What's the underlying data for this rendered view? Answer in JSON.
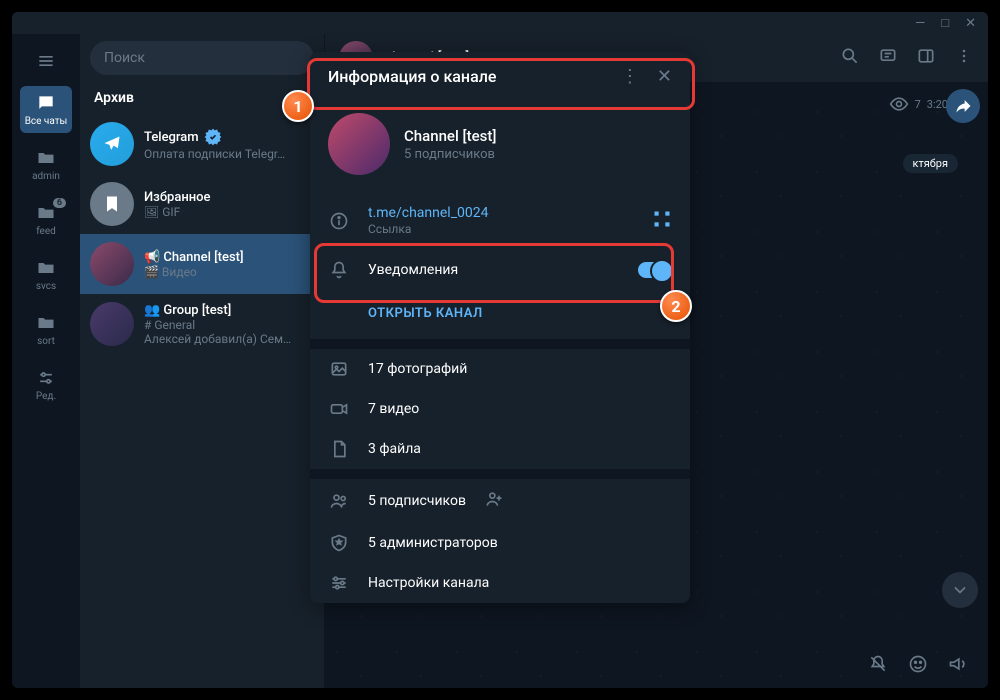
{
  "titlebar": {
    "minimize": "—",
    "maximize": "□",
    "close": "✕"
  },
  "search": {
    "placeholder": "Поиск"
  },
  "leftbar": {
    "all_chats": "Все чаты",
    "admin": "admin",
    "feed": "feed",
    "feed_badge": "6",
    "svcs": "svcs",
    "sort": "sort",
    "edit": "Ред."
  },
  "chatlist": {
    "archive": "Архив",
    "items": [
      {
        "title": "Telegram",
        "verified": true,
        "sub": "Оплата подписки Telegr…"
      },
      {
        "title": "Избранное",
        "sub": "🖼 GIF"
      },
      {
        "title": "📢 Channel [test]",
        "sub": "🎬 Видео"
      },
      {
        "title": "👥 Group [test]",
        "sub": "# General",
        "sub2": "Алексей добавил(а) Сем…"
      }
    ]
  },
  "chat_header": {
    "title": "Channel [test]"
  },
  "msg": {
    "views": "7",
    "time": "3:20"
  },
  "date_pill": "ктября",
  "panel": {
    "title": "Информация о канале",
    "name": "Channel [test]",
    "members": "5 подписчиков",
    "link": "t.me/channel_0024",
    "link_label": "Ссылка",
    "notifications": "Уведомления",
    "open": "ОТКРЫТЬ КАНАЛ",
    "media": {
      "photos": "17 фотографий",
      "videos": "7 видео",
      "files": "3 файла"
    },
    "admin": {
      "subscribers": "5 подписчиков",
      "admins": "5 администраторов",
      "settings": "Настройки канала"
    }
  },
  "callouts": {
    "one": "1",
    "two": "2"
  }
}
